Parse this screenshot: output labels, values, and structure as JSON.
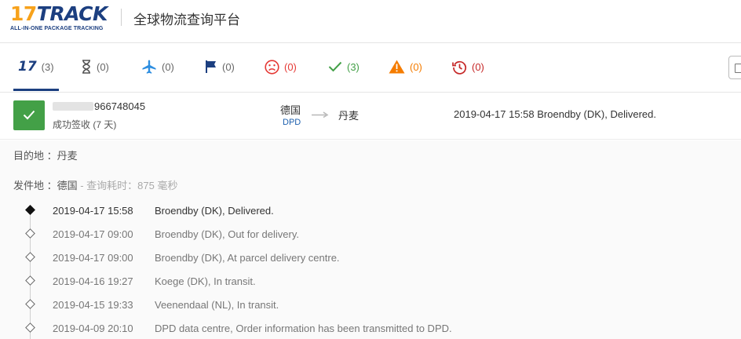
{
  "header": {
    "logo_main_number": "17",
    "logo_main_word": "TRACK",
    "logo_tagline": "ALL-IN-ONE PACKAGE TRACKING",
    "title": "全球物流查询平台"
  },
  "tabs": [
    {
      "name": "all",
      "count": "(3)",
      "icon": "17track-logo-icon",
      "color": "#1c3f80"
    },
    {
      "name": "not-found",
      "count": "(0)",
      "icon": "hourglass-icon",
      "color": "#555555"
    },
    {
      "name": "in-transit",
      "count": "(0)",
      "icon": "airplane-icon",
      "color": "#2d8ee0"
    },
    {
      "name": "pick-up",
      "count": "(0)",
      "icon": "flag-icon",
      "color": "#1c3f80"
    },
    {
      "name": "undelivered",
      "count": "(0)",
      "icon": "sad-face-icon",
      "color": "#e53935"
    },
    {
      "name": "delivered",
      "count": "(3)",
      "icon": "checkmark-icon",
      "color": "#43a047"
    },
    {
      "name": "alert",
      "count": "(0)",
      "icon": "warning-icon",
      "color": "#f57c00"
    },
    {
      "name": "expired",
      "count": "(0)",
      "icon": "history-icon",
      "color": "#c62828"
    }
  ],
  "package": {
    "tracking_number": "966748045",
    "status_text": "成功签收 (7 天)",
    "status_color": "#43a047",
    "origin_country": "德国",
    "carrier": "DPD",
    "destination_country": "丹麦",
    "latest_event": "2019-04-17 15:58  Broendby (DK), Delivered."
  },
  "detail": {
    "destination_label": "目的地 ：丹麦",
    "origin_label": "发件地 ：德国",
    "query_time": " - 查询耗时：875 毫秒",
    "events": [
      {
        "time": "2019-04-17 15:58",
        "description": "Broendby (DK), Delivered."
      },
      {
        "time": "2019-04-17 09:00",
        "description": "Broendby (DK), Out for delivery."
      },
      {
        "time": "2019-04-17 09:00",
        "description": "Broendby (DK), At parcel delivery centre."
      },
      {
        "time": "2019-04-16 19:27",
        "description": "Koege (DK), In transit."
      },
      {
        "time": "2019-04-15 19:33",
        "description": "Veenendaal (NL), In transit."
      },
      {
        "time": "2019-04-09 20:10",
        "description": "DPD data centre, Order information has been transmitted to DPD."
      }
    ]
  }
}
